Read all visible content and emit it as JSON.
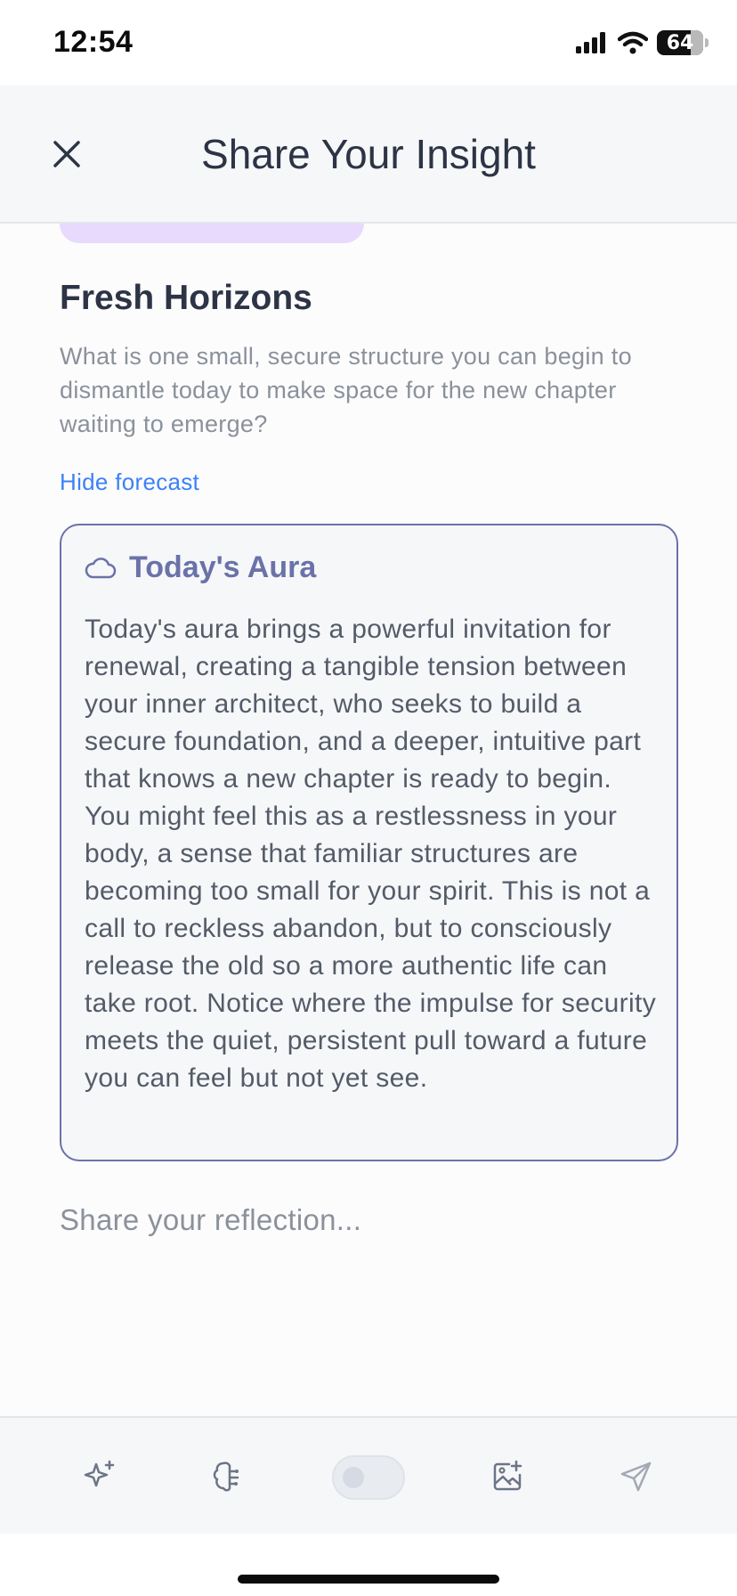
{
  "status_bar": {
    "time": "12:54",
    "battery_level": "64"
  },
  "header": {
    "title": "Share Your Insight",
    "close_icon": "close-icon"
  },
  "prompt": {
    "title": "Fresh Horizons",
    "question": "What is one small, secure structure you can begin to dismantle today to make space for the new chapter waiting to emerge?",
    "hide_link": "Hide forecast"
  },
  "aura": {
    "icon": "cloud-icon",
    "title": "Today's Aura",
    "text": "Today's aura brings a powerful invitation for renewal, creating a tangible tension between your inner architect, who seeks to build a secure foundation, and a deeper, intuitive part that knows a new chapter is ready to begin. You might feel this as a restlessness in your body, a sense that familiar structures are becoming too small for your spirit. This is not a call to reckless abandon, but to consciously release the old so a more authentic life can take root. Notice where the impulse for security meets the quiet, persistent pull toward a future you can feel but not yet see."
  },
  "reflection": {
    "placeholder": "Share your reflection...",
    "value": ""
  },
  "toolbar": {
    "icons": [
      "sparkle-icon",
      "brain-icon",
      "toggle",
      "add-image-icon",
      "send-icon"
    ],
    "toggle_on": false
  },
  "colors": {
    "accent_purple": "#6b72a8",
    "link_blue": "#3b82f6",
    "pill_lavender": "#e7dafc"
  }
}
